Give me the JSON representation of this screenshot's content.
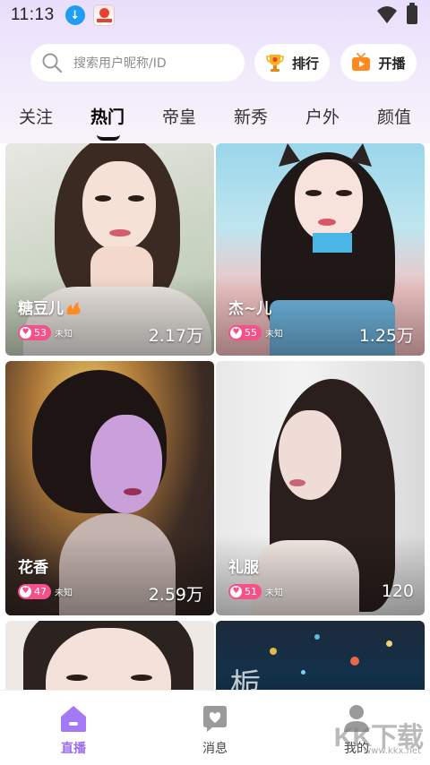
{
  "status_bar": {
    "time": "11:13"
  },
  "search": {
    "placeholder": "搜索用户昵称/ID"
  },
  "header_buttons": {
    "rank_label": "排行",
    "go_live_label": "开播"
  },
  "tabs": [
    {
      "label": "关注",
      "active": false
    },
    {
      "label": "热门",
      "active": true
    },
    {
      "label": "帝皇",
      "active": false
    },
    {
      "label": "新秀",
      "active": false
    },
    {
      "label": "户外",
      "active": false
    },
    {
      "label": "颜值",
      "active": false
    }
  ],
  "streams": [
    {
      "name": "糖豆儿",
      "level": "53",
      "location": "未知",
      "viewers": "2.17万"
    },
    {
      "name": "杰~儿",
      "level": "55",
      "location": "未知",
      "viewers": "1.25万"
    },
    {
      "name": "花香",
      "level": "47",
      "location": "未知",
      "viewers": "2.59万"
    },
    {
      "name": "礼服",
      "level": "51",
      "location": "未知",
      "viewers": "120"
    },
    {
      "name": "",
      "level": "",
      "location": "",
      "viewers": ""
    },
    {
      "name": "",
      "level": "",
      "location": "",
      "viewers": ""
    }
  ],
  "card5_overlay_text": "栀",
  "bottom_nav": [
    {
      "label": "直播",
      "active": true
    },
    {
      "label": "消息",
      "active": false
    },
    {
      "label": "我的",
      "active": false
    }
  ],
  "watermark": {
    "text": "KK下载",
    "url": "www.kkx.net"
  },
  "colors": {
    "accent": "#9b6cf2",
    "level_badge": "#f5508a",
    "header_gradient_top": "#e9defb"
  }
}
